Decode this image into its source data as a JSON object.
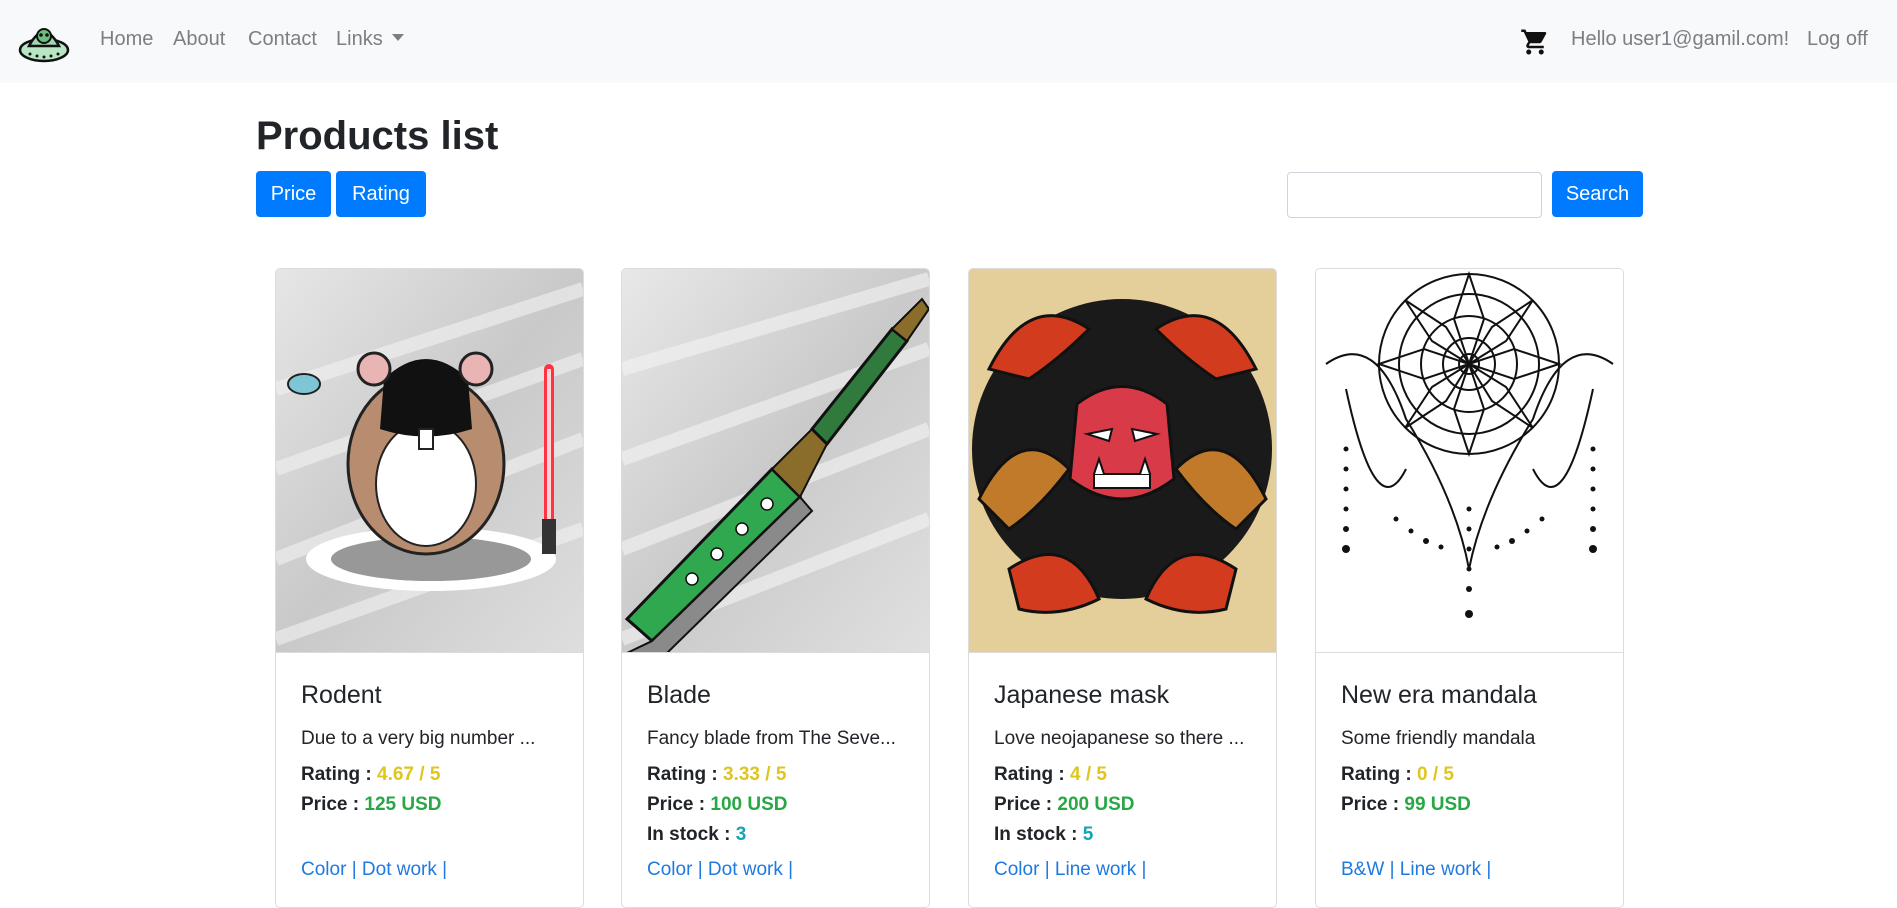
{
  "nav": {
    "home": "Home",
    "about": "About",
    "contact": "Contact",
    "links": "Links",
    "greeting": "Hello user1@gamil.com!",
    "logoff": "Log off",
    "logo_icon": "ufo-alien-icon",
    "cart_icon": "shopping-cart-icon"
  },
  "page": {
    "title": "Products list",
    "sort_price": "Price",
    "sort_rating": "Rating",
    "search_value": "",
    "search_button": "Search"
  },
  "labels": {
    "rating": "Rating :",
    "price": "Price :",
    "stock": "In stock :",
    "separator": "|"
  },
  "products": [
    {
      "name": "Rodent",
      "description": "Due to a very big number ...",
      "rating": "4.67 / 5",
      "price": "125 USD",
      "stock": "",
      "tags": [
        "Color",
        "Dot work"
      ],
      "image": "hamster-darth-vader-illustration"
    },
    {
      "name": "Blade",
      "description": "Fancy blade from The Seve...",
      "rating": "3.33 / 5",
      "price": "100 USD",
      "stock": "3",
      "tags": [
        "Color",
        "Dot work"
      ],
      "image": "green-blade-illustration"
    },
    {
      "name": "Japanese mask",
      "description": "Love neojapanese so there ...",
      "rating": "4 / 5",
      "price": "200 USD",
      "stock": "5",
      "tags": [
        "Color",
        "Line work"
      ],
      "image": "oni-mask-illustration"
    },
    {
      "name": "New era mandala",
      "description": "Some friendly mandala",
      "rating": "0 / 5",
      "price": "99 USD",
      "stock": "",
      "tags": [
        "B&W",
        "Line work"
      ],
      "image": "mandala-illustration"
    }
  ],
  "colors": {
    "primary": "#007bff",
    "rating": "#e0c51f",
    "price": "#28a745",
    "stock": "#17a2b8",
    "link": "#1e7ae0",
    "navbar_bg": "#f8f9fa"
  }
}
